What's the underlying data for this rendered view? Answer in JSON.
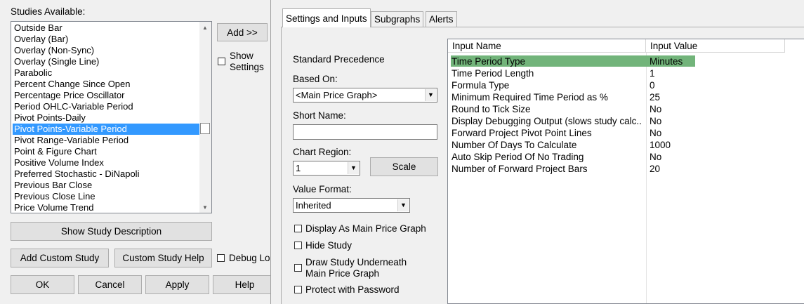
{
  "left": {
    "studies_label": "Studies Available:",
    "studies": [
      "Outside Bar",
      "Overlay (Bar)",
      "Overlay (Non-Sync)",
      "Overlay (Single Line)",
      "Parabolic",
      "Percent Change Since Open",
      "Percentage Price Oscillator",
      "Period OHLC-Variable Period",
      "Pivot Points-Daily",
      "Pivot Points-Variable Period",
      "Pivot Range-Variable Period",
      "Point & Figure Chart",
      "Positive Volume Index",
      "Preferred Stochastic - DiNapoli",
      "Previous Bar Close",
      "Previous Close Line",
      "Price Volume Trend"
    ],
    "selected_study": "Pivot Points-Variable Period",
    "add_button": "Add >>",
    "show_settings": "Show Settings",
    "show_description_button": "Show Study Description",
    "add_custom_button": "Add Custom Study",
    "custom_help_button": "Custom Study Help",
    "debug_label": "Debug Lo",
    "ok_button": "OK",
    "cancel_button": "Cancel",
    "apply_button": "Apply",
    "help_button": "Help"
  },
  "tabs": [
    "Settings and Inputs",
    "Subgraphs",
    "Alerts"
  ],
  "settings": {
    "standard_precedence": "Standard Precedence",
    "based_on_label": "Based On:",
    "based_on_value": "<Main Price Graph>",
    "short_name_label": "Short Name:",
    "short_name_value": "",
    "chart_region_label": "Chart Region:",
    "chart_region_value": "1",
    "scale_button": "Scale",
    "value_format_label": "Value Format:",
    "value_format_value": "Inherited",
    "display_main": "Display As Main Price Graph",
    "hide_study": "Hide Study",
    "draw_underneath_1": "Draw Study Underneath",
    "draw_underneath_2": "Main Price Graph",
    "protect": "Protect with Password"
  },
  "grid": {
    "headers": [
      "Input Name",
      "Input Value"
    ],
    "rows": [
      {
        "name": "Time Period Type",
        "value": "Minutes"
      },
      {
        "name": "Time Period Length",
        "value": "1"
      },
      {
        "name": "Formula Type",
        "value": "0"
      },
      {
        "name": "Minimum Required Time Period as %",
        "value": "25"
      },
      {
        "name": "Round to Tick Size",
        "value": "No"
      },
      {
        "name": "Display Debugging Output (slows study calc...",
        "value": "No"
      },
      {
        "name": "Forward Project Pivot Point Lines",
        "value": "No"
      },
      {
        "name": "Number Of Days To Calculate",
        "value": "1000"
      },
      {
        "name": "Auto Skip Period Of No Trading",
        "value": "No"
      },
      {
        "name": "Number of Forward Project Bars",
        "value": "20"
      }
    ],
    "selected_row_color": "#72b47a"
  }
}
